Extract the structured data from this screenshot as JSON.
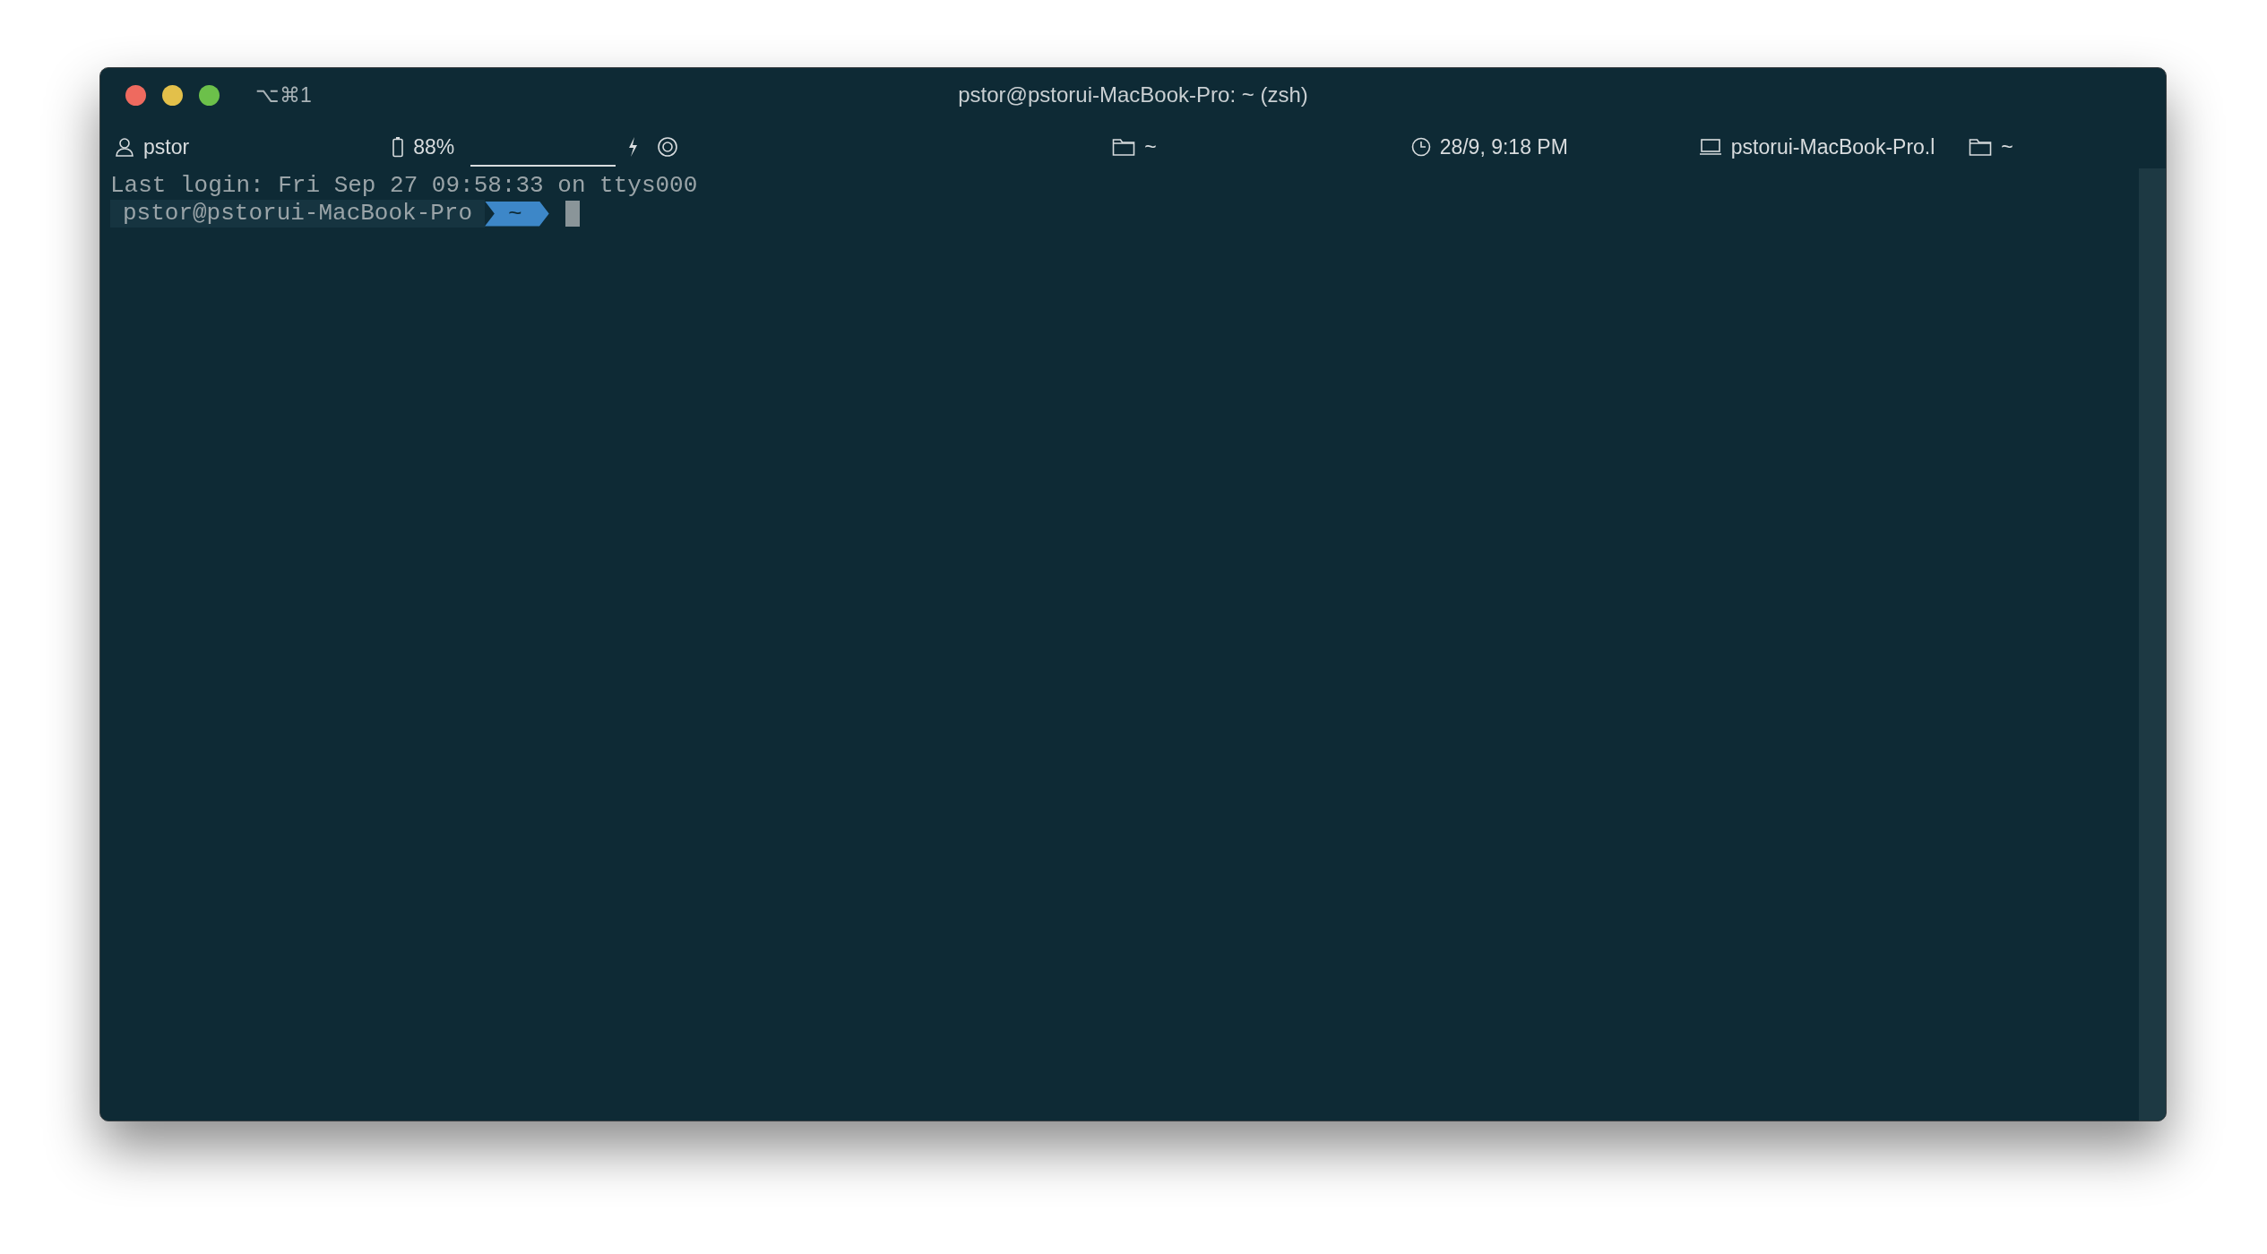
{
  "window": {
    "title": "pstor@pstorui-MacBook-Pro: ~ (zsh)",
    "shortcut": "⌥⌘1"
  },
  "status_bar": [
    {
      "kind": "user",
      "text": "pstor"
    },
    {
      "kind": "battery",
      "text": "88%"
    },
    {
      "kind": "meter"
    },
    {
      "kind": "charging"
    },
    {
      "kind": "target"
    },
    {
      "kind": "folder",
      "text": "~"
    },
    {
      "kind": "clock",
      "text": "28/9, 9:18 PM"
    },
    {
      "kind": "host",
      "text": "pstorui-MacBook-Pro.l"
    },
    {
      "kind": "folder",
      "text": "~"
    }
  ],
  "terminal": {
    "last_login": "Last login: Fri Sep 27 09:58:33 on ttys000",
    "prompt_host": "pstor@pstorui-MacBook-Pro",
    "prompt_dir": "~"
  }
}
